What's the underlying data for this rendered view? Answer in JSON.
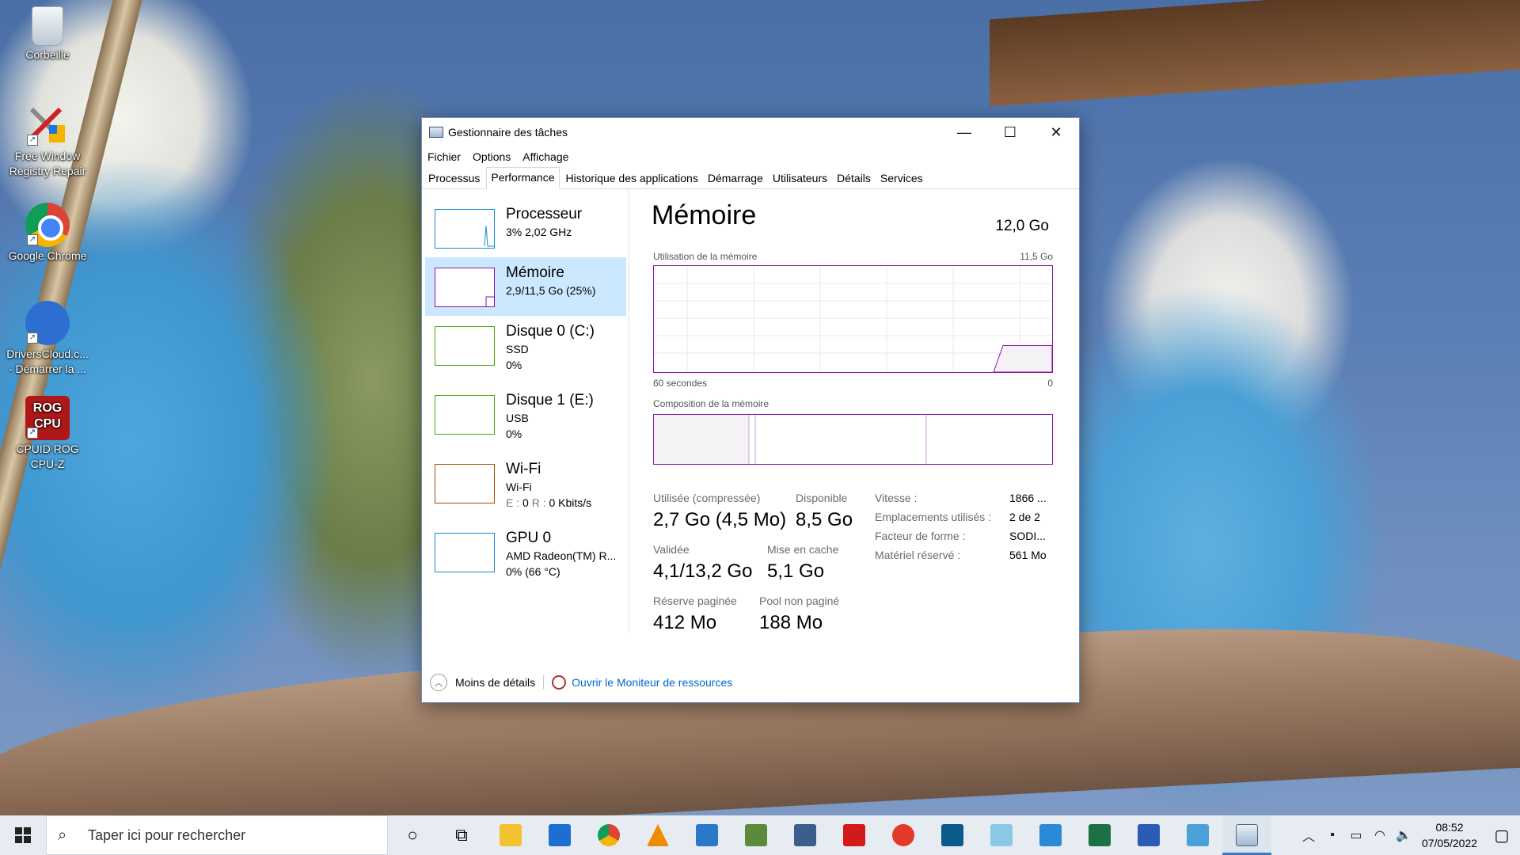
{
  "desktop": {
    "icons": [
      {
        "label": "Corbeille"
      },
      {
        "label": "Free Window Registry Repair"
      },
      {
        "label": "Google Chrome"
      },
      {
        "label": "DriversCloud.c... - Démarrer la ..."
      },
      {
        "label": "CPUID ROG CPU-Z",
        "logo_text": "ROG CPU"
      }
    ]
  },
  "window": {
    "title": "Gestionnaire des tâches",
    "controls": {
      "minimize": "—",
      "maximize": "☐",
      "close": "✕"
    },
    "menu": [
      "Fichier",
      "Options",
      "Affichage"
    ],
    "tabs": [
      "Processus",
      "Performance",
      "Historique des applications",
      "Démarrage",
      "Utilisateurs",
      "Détails",
      "Services"
    ],
    "active_tab": "Performance",
    "sidebar": [
      {
        "name": "Processeur",
        "line2": "3%  2,02 GHz",
        "line3": "",
        "color": "#1a8bd0"
      },
      {
        "name": "Mémoire",
        "line2": "2,9/11,5 Go (25%)",
        "line3": "",
        "color": "#8b12ae"
      },
      {
        "name": "Disque 0 (C:)",
        "line2": "SSD",
        "line3": "0%",
        "color": "#4da60c"
      },
      {
        "name": "Disque 1 (E:)",
        "line2": "USB",
        "line3": "0%",
        "color": "#4da60c"
      },
      {
        "name": "Wi-Fi",
        "line2": "Wi-Fi",
        "line3_e": "E : ",
        "line3_ev": "0",
        "line3_r": " R : ",
        "line3_rv": "0 Kbits/s",
        "color": "#a74f01"
      },
      {
        "name": "GPU 0",
        "line2": "AMD Radeon(TM) R...",
        "line3": "0%  (66 °C)",
        "color": "#1a8bd0"
      }
    ],
    "main": {
      "title": "Mémoire",
      "total": "12,0 Go",
      "usage_label": "Utilisation de la mémoire",
      "usage_max": "11,5 Go",
      "time_left": "60 secondes",
      "time_right": "0",
      "composition_label": "Composition de la mémoire",
      "stats": {
        "used_label": "Utilisée (compressée)",
        "used_value": "2,7 Go (4,5 Mo)",
        "avail_label": "Disponible",
        "avail_value": "8,5 Go",
        "committed_label": "Validée",
        "committed_value": "4,1/13,2 Go",
        "cached_label": "Mise en cache",
        "cached_value": "5,1 Go",
        "paged_label": "Réserve paginée",
        "paged_value": "412 Mo",
        "nonpaged_label": "Pool non paginé",
        "nonpaged_value": "188 Mo"
      },
      "details": [
        {
          "label": "Vitesse :",
          "value": "1866 ..."
        },
        {
          "label": "Emplacements utilisés :",
          "value": "2 de 2"
        },
        {
          "label": "Facteur de forme :",
          "value": "SODI..."
        },
        {
          "label": "Matériel réservé :",
          "value": "561 Mo"
        }
      ],
      "usage_fraction": 0.25
    },
    "footer": {
      "less_details": "Moins de détails",
      "resource_monitor": "Ouvrir le Moniteur de ressources"
    }
  },
  "taskbar": {
    "search_placeholder": "Taper ici pour rechercher",
    "clock_time": "08:52",
    "clock_date": "07/05/2022"
  }
}
